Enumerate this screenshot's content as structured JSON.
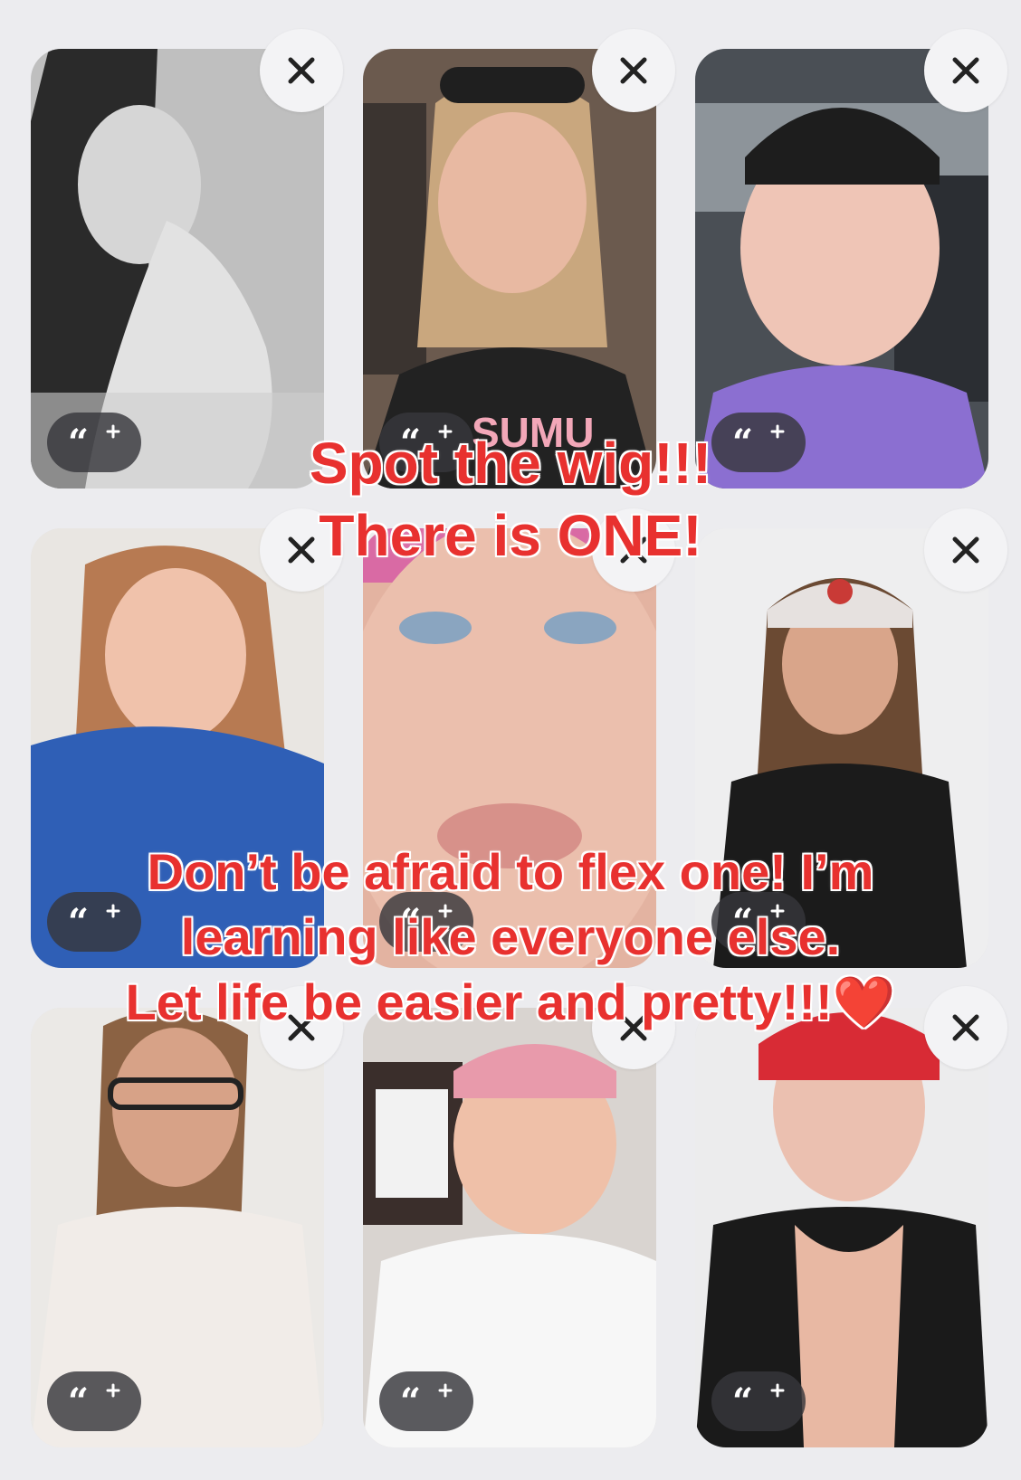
{
  "headline": {
    "line1": "Spot the wig!!!",
    "line2": "There is ONE!"
  },
  "caption": {
    "line1": "Don’t be afraid to flex one! I’m",
    "line2": "learning like everyone else.",
    "line3": "Let life be easier and pretty!!!❤️"
  },
  "cards": [
    {
      "photo": "black-and-white portrait, long dark hair"
    },
    {
      "photo": "selfie, black headband, black t-shirt"
    },
    {
      "photo": "car selfie, black cap, purple top"
    },
    {
      "photo": "smiling, long hair, blue top"
    },
    {
      "photo": "close-up face, pink headwrap"
    },
    {
      "photo": "red-and-white cap, black tank top"
    },
    {
      "photo": "glasses, ponytail, white tank top"
    },
    {
      "photo": "pink headband, white t-shirt"
    },
    {
      "photo": "red headwrap, black top"
    }
  ],
  "icons": {
    "close": "close-icon",
    "quote": "quote-plus-icon"
  },
  "colors": {
    "caption_text": "#e8312f",
    "caption_outline": "#ffffff",
    "background": "#ececef",
    "close_button": "#f3f3f5",
    "quote_button": "#37373c"
  }
}
